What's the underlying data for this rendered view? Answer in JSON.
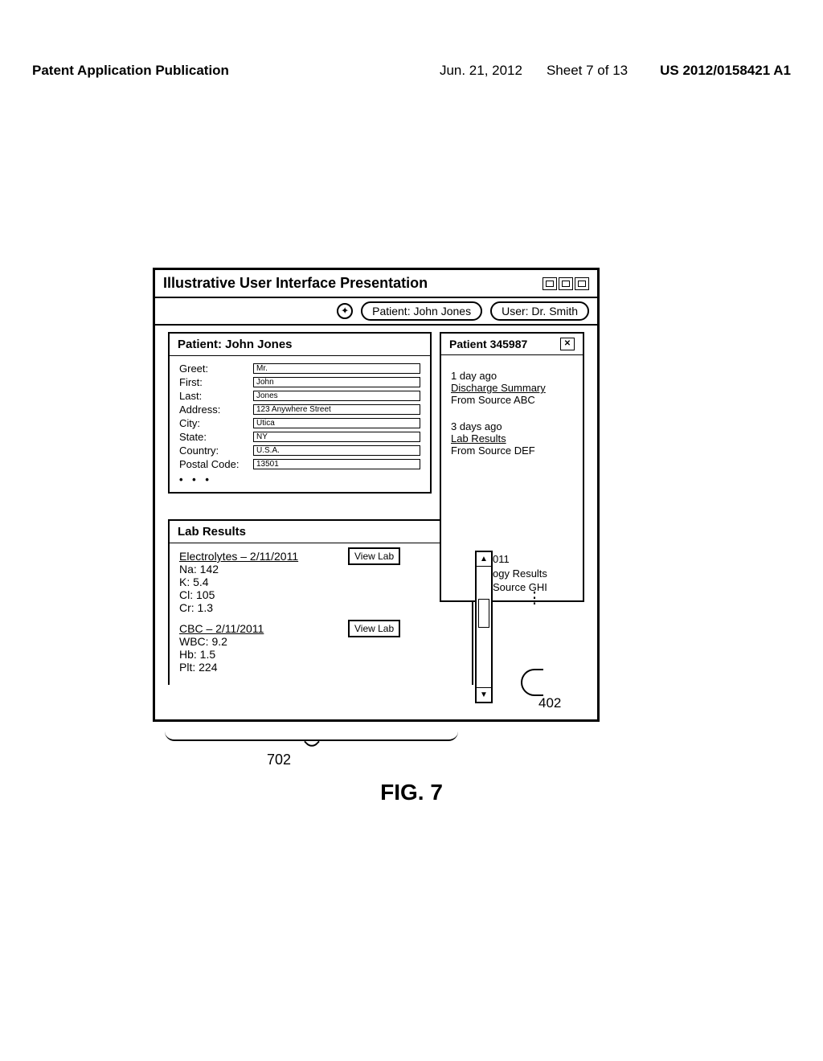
{
  "header": {
    "pub_line": "Patent Application Publication",
    "date": "Jun. 21, 2012",
    "sheet": "Sheet 7 of 13",
    "pub_number": "US 2012/0158421 A1"
  },
  "window": {
    "title": "Illustrative User Interface Presentation",
    "toolbar": {
      "patient_pill": "Patient: John Jones",
      "user_pill": "User: Dr. Smith"
    }
  },
  "patient_panel": {
    "heading": "Patient: John Jones",
    "fields": {
      "greet_label": "Greet:",
      "greet_value": "Mr.",
      "first_label": "First:",
      "first_value": "John",
      "last_label": "Last:",
      "last_value": "Jones",
      "address_label": "Address:",
      "address_value": "123 Anywhere Street",
      "city_label": "City:",
      "city_value": "Utica",
      "state_label": "State:",
      "state_value": "NY",
      "country_label": "Country:",
      "country_value": "U.S.A.",
      "postal_label": "Postal Code:",
      "postal_value": "13501"
    },
    "ellipsis": "• • •"
  },
  "labs_panel": {
    "heading": "Lab Results",
    "entries": [
      {
        "title": "Electrolytes – 2/11/2011",
        "btn": "View Lab",
        "lines": [
          "Na: 142",
          "K: 5.4",
          "Cl: 105",
          "Cr: 1.3"
        ]
      },
      {
        "title": "CBC – 2/11/2011",
        "btn": "View Lab",
        "lines": [
          "WBC: 9.2",
          "Hb: 1.5",
          "Plt: 224"
        ]
      }
    ]
  },
  "sticky_panel": {
    "heading": "Patient 345987",
    "items": [
      {
        "time": "1 day ago",
        "link": "Discharge Summary",
        "source": "From Source ABC"
      },
      {
        "time": "3 days ago",
        "link": "Lab Results",
        "source": "From Source DEF"
      }
    ],
    "peek": {
      "line1": "011",
      "line2": "ogy Results",
      "line3": "Source GHI"
    }
  },
  "callouts": {
    "c402": "402",
    "c702": "702"
  },
  "figure_label": "FIG. 7"
}
